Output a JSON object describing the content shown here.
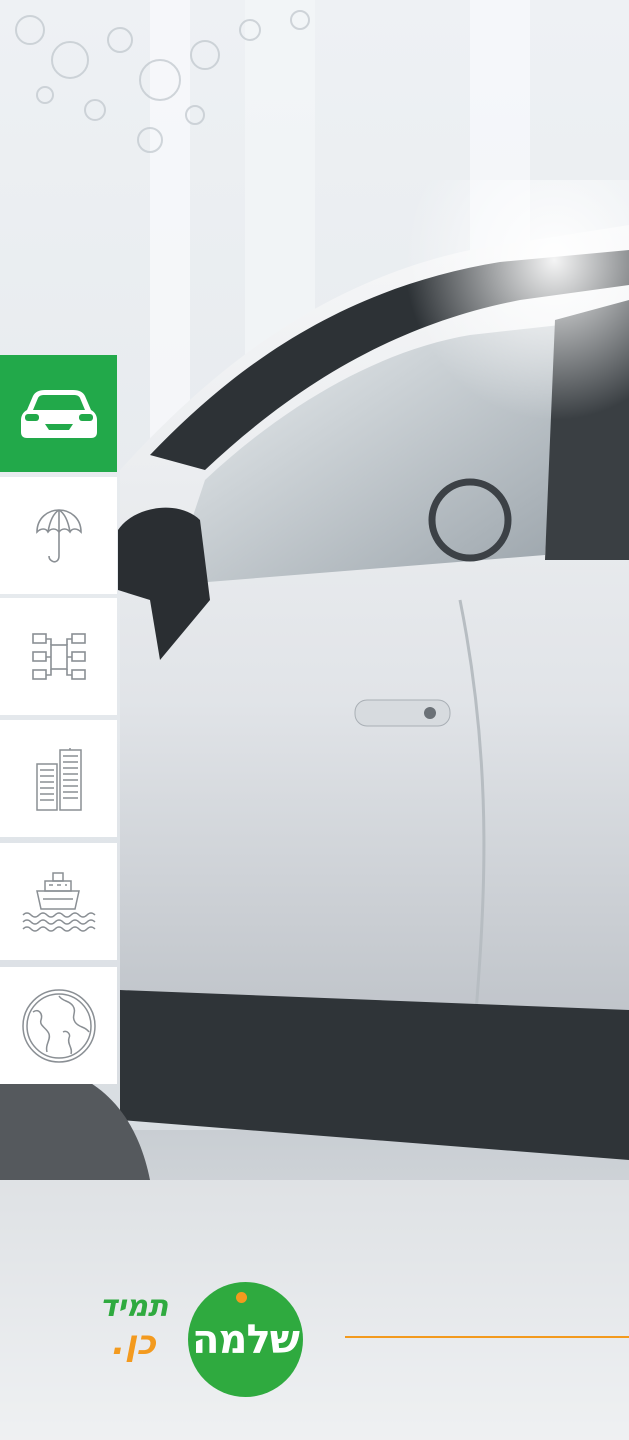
{
  "nav": {
    "items": [
      {
        "id": "car",
        "icon": "car-icon",
        "active": true
      },
      {
        "id": "umbrella",
        "icon": "umbrella-icon",
        "active": false
      },
      {
        "id": "structure",
        "icon": "org-chart-icon",
        "active": false
      },
      {
        "id": "buildings",
        "icon": "buildings-icon",
        "active": false
      },
      {
        "id": "ship",
        "icon": "ship-icon",
        "active": false
      },
      {
        "id": "globe",
        "icon": "globe-icon",
        "active": false
      }
    ]
  },
  "brand": {
    "logo_text": "שלמה",
    "slogan_line1": "תמיד",
    "slogan_line2": "כן."
  },
  "colors": {
    "accent_green": "#22a94a",
    "logo_green": "#2faa3f",
    "accent_orange": "#f39a1e",
    "icon_gray": "#8a8f94"
  }
}
